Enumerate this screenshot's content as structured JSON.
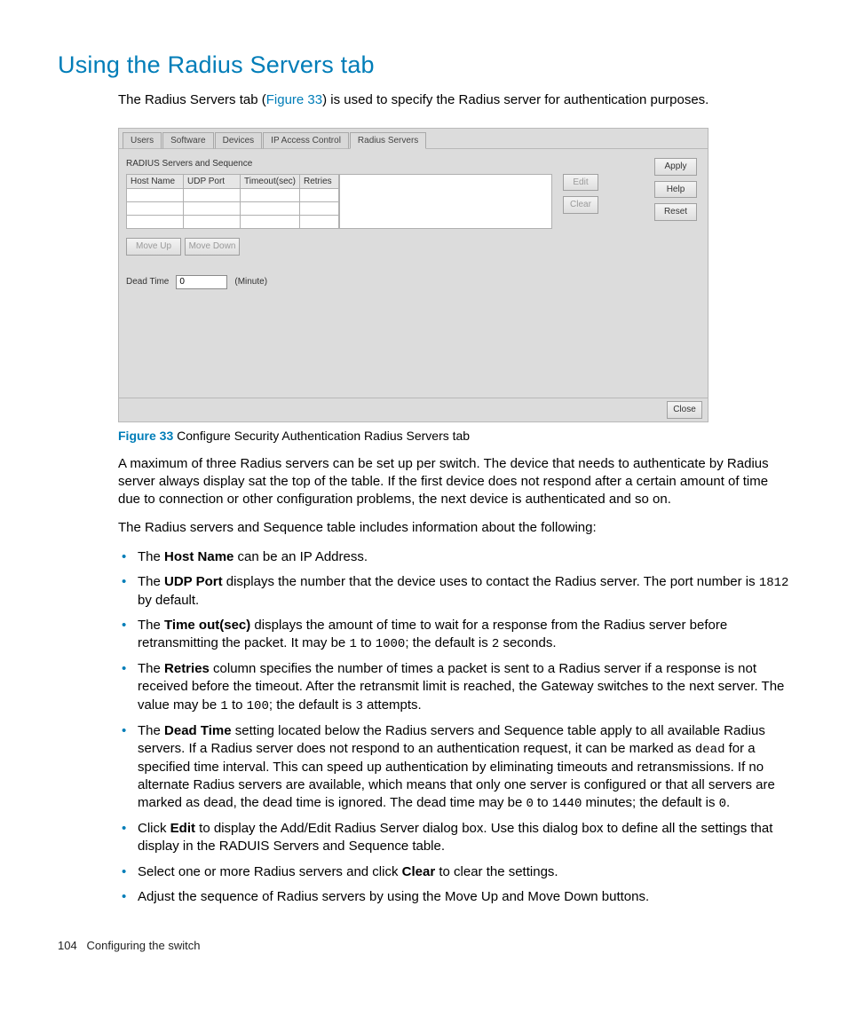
{
  "heading": "Using the Radius Servers tab",
  "intro_before": "The Radius Servers tab (",
  "intro_figref": "Figure 33",
  "intro_after": ") is used to specify the Radius server for authentication purposes.",
  "panel": {
    "tabs": [
      "Users",
      "Software",
      "Devices",
      "IP Access Control",
      "Radius Servers"
    ],
    "active_tab_index": 4,
    "group_title": "RADIUS Servers and Sequence",
    "columns": [
      "Host Name",
      "UDP Port",
      "Timeout(sec)",
      "Retries"
    ],
    "rows": [
      [
        "",
        "",
        "",
        ""
      ],
      [
        "",
        "",
        "",
        ""
      ],
      [
        "",
        "",
        "",
        ""
      ]
    ],
    "edit_btn": "Edit",
    "clear_btn": "Clear",
    "moveup_btn": "Move Up",
    "movedown_btn": "Move Down",
    "deadtime_label": "Dead Time",
    "deadtime_value": "0",
    "deadtime_unit": "(Minute)",
    "apply_btn": "Apply",
    "help_btn": "Help",
    "reset_btn": "Reset",
    "close_btn": "Close"
  },
  "figure": {
    "num": "Figure 33",
    "caption": " Configure Security Authentication Radius Servers tab"
  },
  "para1": "A maximum of three Radius servers can be set up per switch. The device that needs to authenticate by Radius server always display sat the top of the table. If the first device does not respond after a certain amount of time due to connection or other configuration problems, the next device is authenticated and so on.",
  "para2": "The Radius servers and Sequence table includes information about the following:",
  "bullets": {
    "b0_a": "The ",
    "b0_bold": "Host Name",
    "b0_b": " can be an IP Address.",
    "b1_a": "The ",
    "b1_bold": "UDP Port",
    "b1_b": " displays the number that the device uses to contact the Radius server. The port number is ",
    "b1_mono": "1812",
    "b1_c": " by default.",
    "b2_a": "The ",
    "b2_bold": "Time out(sec)",
    "b2_b": " displays the amount of time to wait for a response from the Radius server before retransmitting the packet. It may be ",
    "b2_m1": "1",
    "b2_c": " to ",
    "b2_m2": "1000",
    "b2_d": "; the default is ",
    "b2_m3": "2",
    "b2_e": " seconds.",
    "b3_a": "The ",
    "b3_bold": "Retries",
    "b3_b": " column specifies the number of times a packet is sent to a Radius server if a response is not received before the timeout. After the retransmit limit is reached, the Gateway switches to the next server. The value may be ",
    "b3_m1": "1",
    "b3_c": " to ",
    "b3_m2": "100",
    "b3_d": "; the default is ",
    "b3_m3": "3",
    "b3_e": "  attempts.",
    "b4_a": "The ",
    "b4_bold": "Dead Time",
    "b4_b": " setting located below the Radius servers and Sequence table apply to all available Radius servers. If a Radius server does not respond to an authentication request, it can be marked as ",
    "b4_m1": "dead",
    "b4_c": " for a specified time interval. This can speed up authentication by eliminating timeouts and retransmissions. If no alternate Radius servers are available, which means that only one server is configured or that all servers are marked as dead, the dead time is ignored. The dead time may be ",
    "b4_m2": "0",
    "b4_d": " to ",
    "b4_m3": "1440",
    "b4_e": " minutes; the default is ",
    "b4_m4": "0",
    "b4_f": ".",
    "b5_a": "Click ",
    "b5_bold": "Edit",
    "b5_b": " to display the Add/Edit Radius Server dialog box. Use this dialog box to define all the settings that display in the RADUIS Servers and Sequence table.",
    "b6_a": "Select one or more Radius servers and click ",
    "b6_bold": "Clear",
    "b6_b": " to clear the settings.",
    "b7": "Adjust the sequence of Radius servers by using the Move Up and Move Down buttons."
  },
  "footer": {
    "page": "104",
    "section": "Configuring the switch"
  }
}
